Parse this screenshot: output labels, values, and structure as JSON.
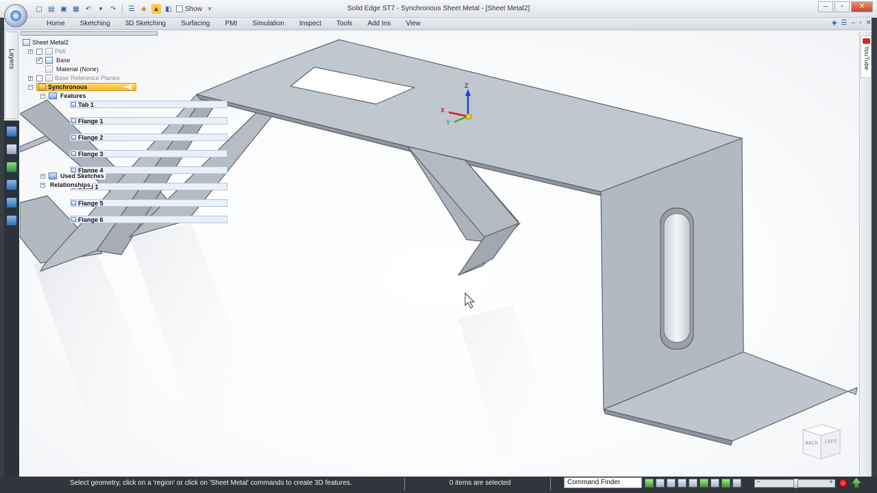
{
  "window": {
    "title": "Solid Edge ST7 - Synchronous Sheet Metal - [Sheet Metal2]",
    "minimize": "–",
    "restore": "▫",
    "close": "✕"
  },
  "quick_access": {
    "show_label": "Show"
  },
  "ribbon": {
    "tabs": [
      "Home",
      "Sketching",
      "3D Sketching",
      "Surfacing",
      "PMI",
      "Simulation",
      "Inspect",
      "Tools",
      "Add Ins",
      "View"
    ]
  },
  "side_panel": {
    "layers_label": "Layers",
    "youtube_label": "YouTube"
  },
  "pathfinder": {
    "root": "Sheet Metal2",
    "pmi": "PMI",
    "base": "Base",
    "material": "Material (None)",
    "base_reference_planes": "Base Reference Planes",
    "synchronous": "Synchronous",
    "features": "Features",
    "feature_items": [
      "Tab 1",
      "Flange 1",
      "Flange 2",
      "Flange 3",
      "Flange 4",
      "Bead 1",
      "Flange 5",
      "Flange 6"
    ],
    "used_sketches": "Used Sketches",
    "relationships": "Relationships"
  },
  "triad": {
    "x": "X",
    "y": "Y",
    "z": "Z",
    "colors": {
      "x": "#e01818",
      "y": "#2fb02f",
      "z": "#1a3fe0",
      "origin": "#f2d21a"
    }
  },
  "view_cube": {
    "back": "BACK",
    "left": "LEFT"
  },
  "status_bar": {
    "prompt": "Select geometry, click on a 'region' or click on 'Sheet Metal' commands to create 3D features.",
    "selection": "0 items are selected",
    "command_finder": "Command Finder"
  },
  "colors": {
    "part_fill": "#b8bec6",
    "part_stroke": "#5d636b",
    "sync_highlight": "#f3b62d",
    "status_bg": "#32363c"
  }
}
